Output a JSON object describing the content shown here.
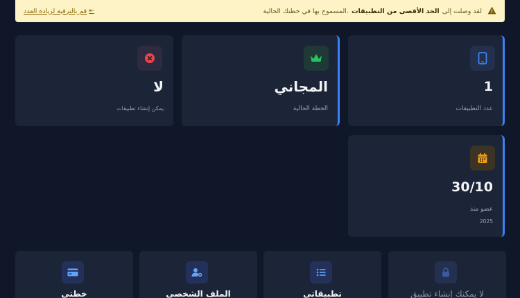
{
  "alert": {
    "icon": "warning-icon",
    "prefix": "لقد وصلت إلى",
    "bold": "الحد الأقصى من التطبيقات",
    "suffix": "المسموح بها في خطتك الحالية.",
    "link": "قم بالترقية لزيادة العدد"
  },
  "stats": {
    "apps": {
      "value": "1",
      "label": "عدد التطبيقات",
      "icon": "phone-icon",
      "color": "#3b82f6"
    },
    "plan": {
      "value": "المجاني",
      "label": "الخطة الحالية",
      "icon": "crown-icon",
      "color": "#22c55e"
    },
    "create": {
      "value": "لا",
      "label": "يمكن إنشاء تطبيقات",
      "icon": "x-circle-icon",
      "color": "#ef4444"
    },
    "member": {
      "value": "30/10",
      "label": "عضو منذ",
      "sub": "2025",
      "icon": "calendar-icon",
      "color": "#f59e0b"
    }
  },
  "nav": [
    {
      "label": "لا يمكنك إنشاء تطبيق",
      "icon": "lock-icon",
      "disabled": true
    },
    {
      "label": "تطبيقاتي",
      "icon": "list-icon"
    },
    {
      "label": "الملف الشخصي",
      "icon": "user-edit-icon"
    },
    {
      "label": "خطتي",
      "icon": "credit-card-icon"
    }
  ]
}
